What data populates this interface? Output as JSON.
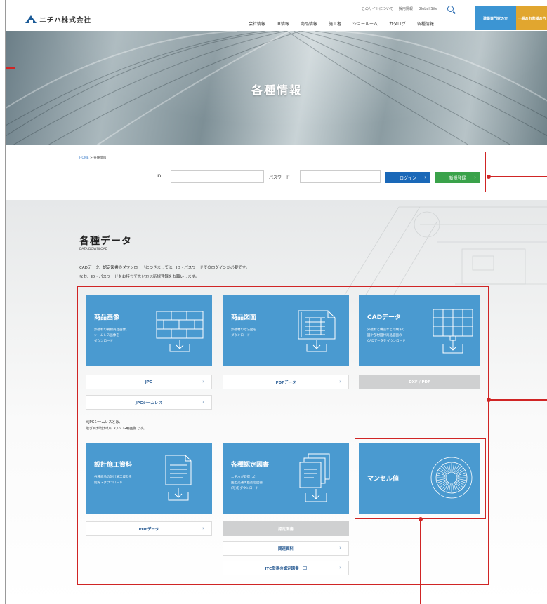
{
  "header": {
    "logo": "ニチハ株式会社",
    "util_links": [
      "このサイトについて",
      "採用情報",
      "Global Site"
    ],
    "nav": [
      "会社情報",
      "IR情報",
      "商品情報",
      "施工者",
      "ショールーム",
      "カタログ",
      "各種情報"
    ],
    "btn_pro": "建築専門家の方",
    "btn_general": "一般のお客様の方"
  },
  "hero": {
    "title": "各種情報"
  },
  "breadcrumb": {
    "home": "HOME",
    "sep": ">",
    "current": "各種情報"
  },
  "login": {
    "id_label": "ID",
    "password_label": "パスワード",
    "login_button": "ログイン",
    "register_button": "新規登録"
  },
  "section": {
    "title": "各種データ",
    "subtitle": "DATA DOWNLOAD",
    "desc1": "CADデータ、認定図書のダウンロードにつきましては、ID・パスワードでのログインが必要です。",
    "desc2": "なお、ID・パスワードをお持ちでない方は新規登録をお願いします。"
  },
  "cards": {
    "product_image": {
      "title": "商品画像",
      "desc": "外壁材の要物商品画像、\nシームレス画像を\nダウンロード",
      "links": [
        "JPG",
        "JPGシームレス"
      ]
    },
    "product_drawing": {
      "title": "商品図面",
      "desc": "外壁材の寸法図を\nダウンロード",
      "links": [
        "PDFデータ"
      ]
    },
    "cad": {
      "title": "CADデータ",
      "desc": "外壁材と構造などの納まり\n図や部材図付商品図面の\nCADデータをダウンロード",
      "links": [
        "DXF / PDF"
      ]
    },
    "design": {
      "title": "設計施工資料",
      "desc": "各種商品の設計施工資料を\n閲覧・ダウンロード",
      "links": [
        "PDFデータ"
      ]
    },
    "cert": {
      "title": "各種認定図書",
      "desc": "ニチハが取得した\n国土交通大臣認定図書\n(写)をダウンロード",
      "links": [
        "認定図書",
        "関連資料",
        "JTC取得の認定図書"
      ]
    },
    "munsell": {
      "title": "マンセル値"
    }
  },
  "note": "※JPGシームレスとは、\n継ぎ目が分かりにくいCG用画像です。",
  "colors": {
    "card_blue": "#4a9ad0",
    "login_blue": "#1a68b8",
    "register_green": "#3aa24a",
    "annotation_red": "#d02525",
    "btn_orange": "#e1a62f"
  }
}
